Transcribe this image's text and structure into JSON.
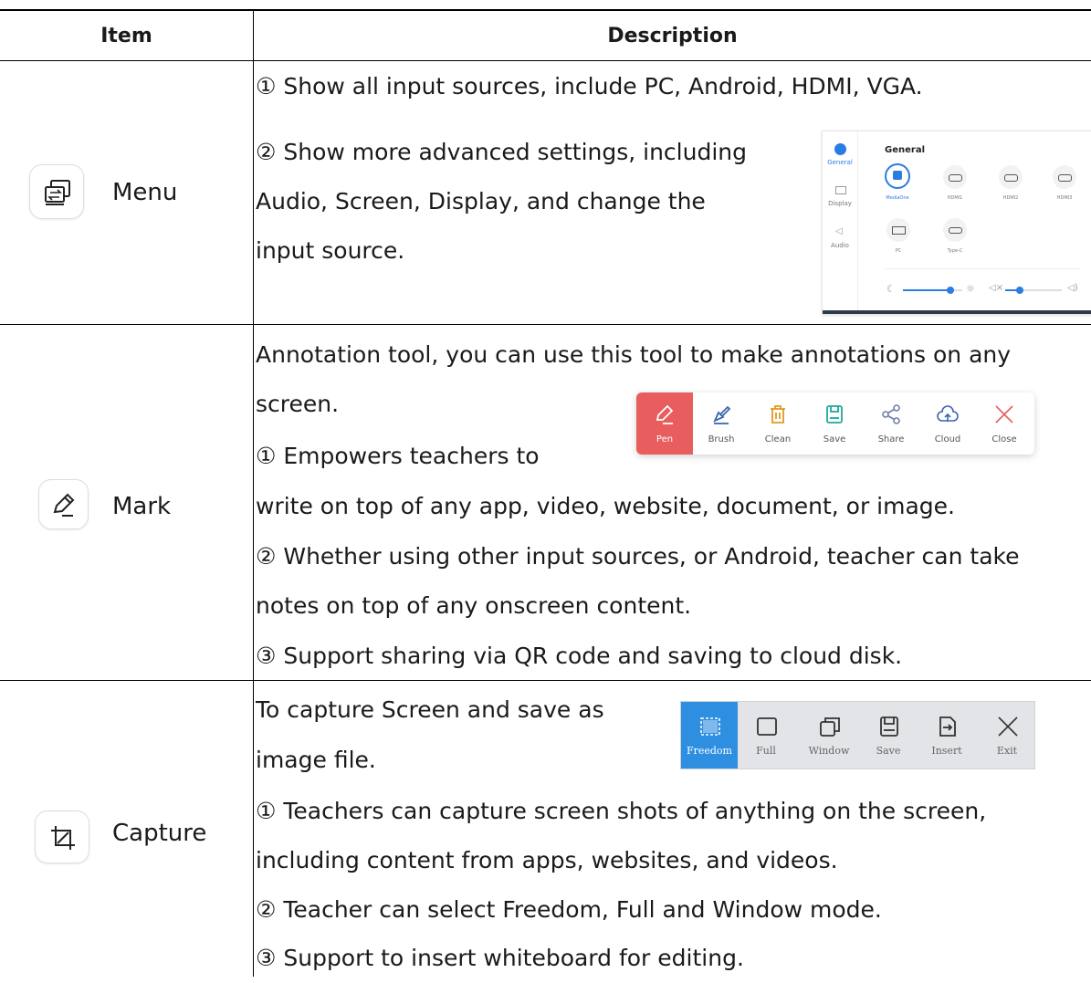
{
  "table": {
    "header": {
      "item": "Item",
      "description": "Description"
    },
    "rows": {
      "menu": {
        "name": "Menu",
        "icon": "input-source-icon",
        "lines": [
          "① Show all input sources, include PC, Android, HDMI, VGA.",
          "② Show more advanced settings, including",
          "Audio, Screen, Display, and change the",
          "input source."
        ]
      },
      "mark": {
        "name": "Mark",
        "icon": "pencil-icon",
        "lines": [
          "Annotation tool, you can use this tool to make annotations on any",
          "screen.",
          "① Empowers teachers to",
          "write on top of any app, video, website, document, or image.",
          "② Whether using other input sources, or Android, teacher can take",
          "notes on top of any onscreen content.",
          "③ Support sharing via QR code and saving to cloud disk."
        ]
      },
      "capture": {
        "name": "Capture",
        "icon": "crop-icon",
        "lines": [
          "To capture Screen and save as",
          "image file.",
          "① Teachers can capture screen shots of anything on the screen,",
          "including content from apps, websites, and videos.",
          "② Teacher can select Freedom, Full and Window mode.",
          "③ Support to insert whiteboard for editing."
        ]
      }
    }
  },
  "menu_panel": {
    "sidebar": [
      "General",
      "Display",
      "Audio"
    ],
    "title": "General",
    "sources": [
      "MediaOne",
      "HDMI1",
      "HDMI2",
      "HDMI3",
      "PC",
      "Type-C"
    ],
    "brightness_level": 0.8,
    "volume_level": 0.25,
    "accent": "#2a7de1"
  },
  "mark_toolbar": {
    "buttons": [
      "Pen",
      "Brush",
      "Clean",
      "Save",
      "Share",
      "Cloud",
      "Close"
    ],
    "active": "Pen",
    "active_color": "#e85d5d"
  },
  "capture_toolbar": {
    "buttons": [
      "Freedom",
      "Full",
      "Window",
      "Save",
      "Insert",
      "Exit"
    ],
    "active": "Freedom",
    "active_color": "#2e8fe0"
  }
}
